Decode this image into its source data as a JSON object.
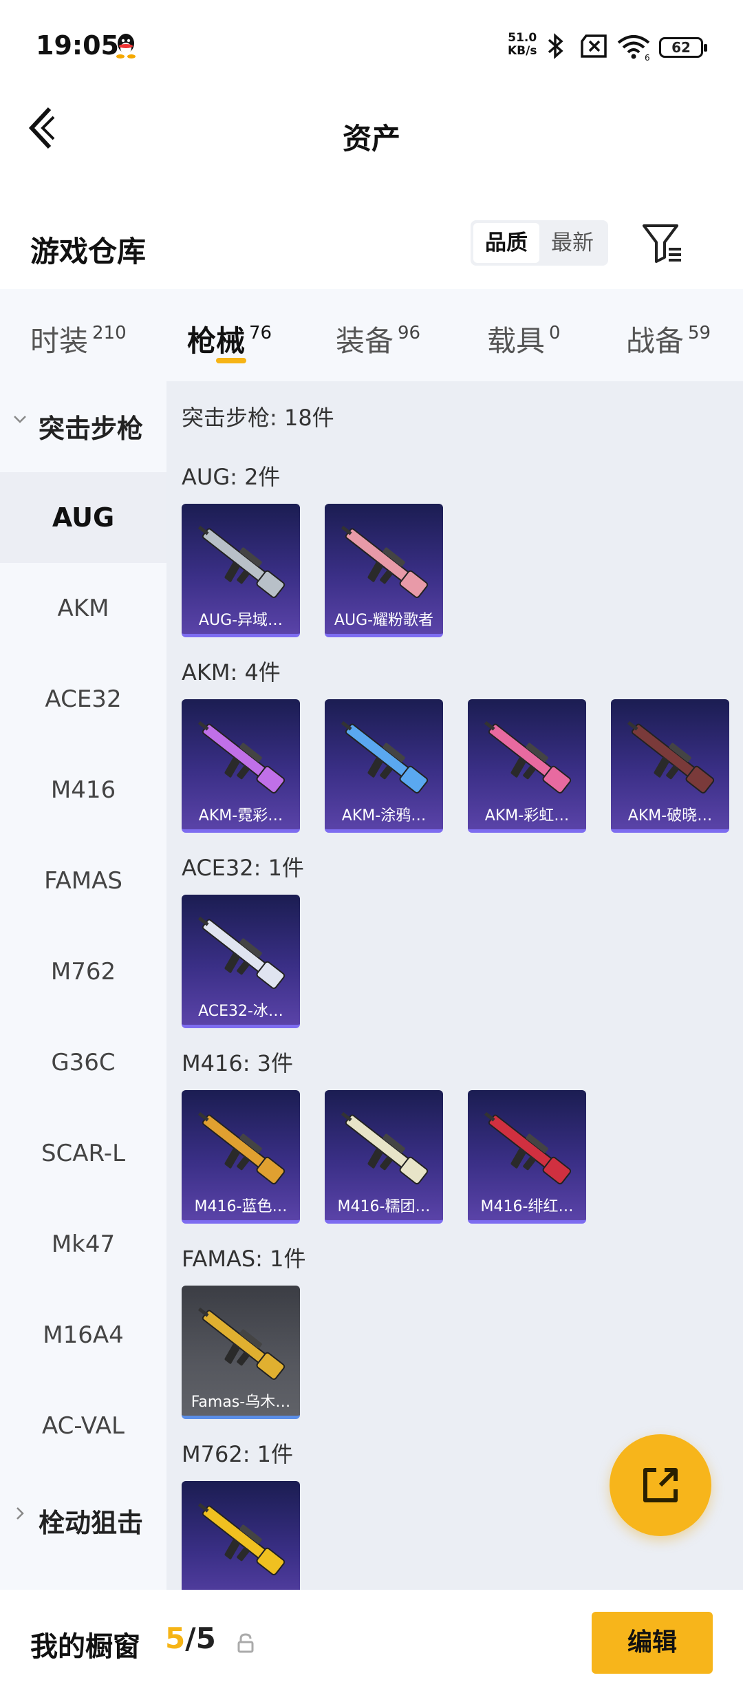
{
  "status_bar": {
    "time": "19:05",
    "net_speed_value": "51.0",
    "net_speed_unit": "KB/s",
    "wifi_label": "6",
    "battery": "62"
  },
  "header": {
    "title": "资产"
  },
  "warehouse": {
    "title": "游戏仓库",
    "sort_options": [
      "品质",
      "最新"
    ],
    "sort_selected": "品质"
  },
  "tabs": [
    {
      "label": "时装",
      "count": "210",
      "active": false
    },
    {
      "label": "枪械",
      "count": "76",
      "active": true
    },
    {
      "label": "装备",
      "count": "96",
      "active": false
    },
    {
      "label": "载具",
      "count": "0",
      "active": false
    },
    {
      "label": "战备",
      "count": "59",
      "active": false
    }
  ],
  "sidebar": {
    "group_expanded": "突击步枪",
    "items": [
      "AUG",
      "AKM",
      "ACE32",
      "M416",
      "FAMAS",
      "M762",
      "G36C",
      "SCAR-L",
      "Mk47",
      "M16A4",
      "AC-VAL"
    ],
    "active_item": "AUG",
    "group_collapsed": "栓动狙击"
  },
  "content": {
    "category_summary": "突击步枪: 18件",
    "sections": [
      {
        "header": "AUG: 2件",
        "items": [
          {
            "name": "AUG-异域…",
            "color": "#b8c0c8",
            "style": "purple"
          },
          {
            "name": "AUG-耀粉歌者",
            "color": "#e89aa8",
            "style": "purple"
          }
        ]
      },
      {
        "header": "AKM: 4件",
        "items": [
          {
            "name": "AKM-霓彩…",
            "color": "#c070e8",
            "style": "purple"
          },
          {
            "name": "AKM-涂鸦…",
            "color": "#5aa8f0",
            "style": "purple"
          },
          {
            "name": "AKM-彩虹…",
            "color": "#e86aa0",
            "style": "purple"
          },
          {
            "name": "AKM-破晓…",
            "color": "#7a3a3a",
            "style": "purple"
          }
        ]
      },
      {
        "header": "ACE32: 1件",
        "items": [
          {
            "name": "ACE32-冰…",
            "color": "#e0e4f0",
            "style": "purple"
          }
        ]
      },
      {
        "header": "M416: 3件",
        "items": [
          {
            "name": "M416-蓝色…",
            "color": "#e0a030",
            "style": "purple"
          },
          {
            "name": "M416-糯团…",
            "color": "#e8e4c8",
            "style": "purple"
          },
          {
            "name": "M416-绯红…",
            "color": "#d03040",
            "style": "purple"
          }
        ]
      },
      {
        "header": "FAMAS: 1件",
        "items": [
          {
            "name": "Famas-乌木…",
            "color": "#e0b030",
            "style": "gray"
          }
        ]
      },
      {
        "header": "M762: 1件",
        "items": [
          {
            "name": "",
            "color": "#f0c020",
            "style": "purple"
          }
        ]
      }
    ]
  },
  "bottom_bar": {
    "label": "我的橱窗",
    "current": "5",
    "separator": "/",
    "max": "5",
    "edit_label": "编辑"
  },
  "colors": {
    "accent": "#f7b51b",
    "tab_indicator": "#f6b416"
  }
}
